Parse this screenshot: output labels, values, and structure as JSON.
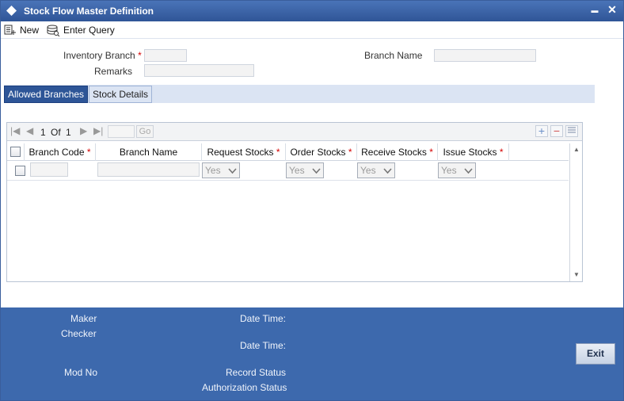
{
  "window": {
    "title": "Stock Flow Master Definition",
    "minimize_glyph": "▬",
    "close_glyph": "✕"
  },
  "toolbar": {
    "new_label": "New",
    "enter_query_label": "Enter Query"
  },
  "form": {
    "inventory_branch_label": "Inventory Branch",
    "inventory_branch_value": "",
    "remarks_label": "Remarks",
    "remarks_value": "",
    "branch_name_label": "Branch Name",
    "branch_name_value": "",
    "required_mark": "*"
  },
  "tabs": [
    {
      "label": "Allowed Branches",
      "active": true
    },
    {
      "label": "Stock Details",
      "active": false
    }
  ],
  "grid": {
    "pager": {
      "current_page": "1",
      "of_label": "Of",
      "total_pages": "1",
      "go_label": "Go"
    },
    "columns": [
      {
        "label": "Branch Code",
        "required": true
      },
      {
        "label": "Branch Name",
        "required": false
      },
      {
        "label": "Request Stocks",
        "required": true
      },
      {
        "label": "Order Stocks",
        "required": true
      },
      {
        "label": "Receive Stocks",
        "required": true
      },
      {
        "label": "Issue Stocks",
        "required": true
      }
    ],
    "rows": [
      {
        "branch_code": "",
        "branch_name": "",
        "request_stocks": "Yes",
        "order_stocks": "Yes",
        "receive_stocks": "Yes",
        "issue_stocks": "Yes"
      }
    ]
  },
  "footer": {
    "maker_label": "Maker",
    "checker_label": "Checker",
    "date_time_label": "Date Time:",
    "mod_no_label": "Mod No",
    "record_status_label": "Record Status",
    "authorization_status_label": "Authorization Status",
    "exit_label": "Exit"
  },
  "colors": {
    "title_bar": "#2f5597",
    "footer": "#3d69ad",
    "active_tab": "#2d5597",
    "required": "#d40000"
  }
}
